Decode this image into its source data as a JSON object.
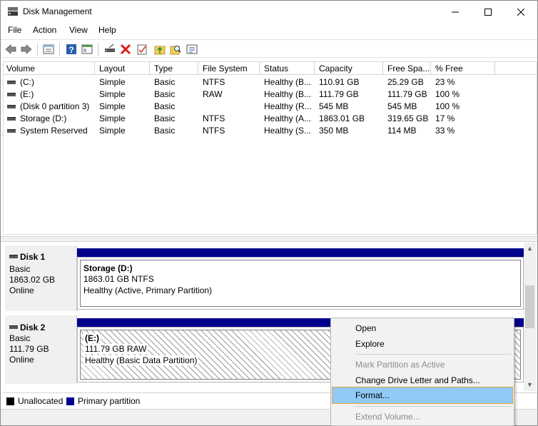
{
  "window": {
    "title": "Disk Management"
  },
  "menu": [
    "File",
    "Action",
    "View",
    "Help"
  ],
  "toolbar": {
    "icons": [
      "back-arrow-icon",
      "forward-arrow-icon",
      "properties-pane-icon",
      "help-icon",
      "console-tree-icon",
      "connect-drive-icon",
      "delete-icon",
      "check-properties-icon",
      "folder-up-icon",
      "search-folder-icon",
      "settings-list-icon"
    ],
    "accent_red": "#d81e1e",
    "accent_blue": "#2a5db0"
  },
  "volume_list": {
    "columns": [
      "Volume",
      "Layout",
      "Type",
      "File System",
      "Status",
      "Capacity",
      "Free Spa...",
      "% Free"
    ],
    "rows": [
      {
        "volume": "(C:)",
        "layout": "Simple",
        "type": "Basic",
        "fs": "NTFS",
        "status": "Healthy (B...",
        "capacity": "110.91 GB",
        "free": "25.29 GB",
        "pct": "23 %"
      },
      {
        "volume": "(E:)",
        "layout": "Simple",
        "type": "Basic",
        "fs": "RAW",
        "status": "Healthy (B...",
        "capacity": "111.79 GB",
        "free": "111.79 GB",
        "pct": "100 %"
      },
      {
        "volume": "(Disk 0 partition 3)",
        "layout": "Simple",
        "type": "Basic",
        "fs": "",
        "status": "Healthy (R...",
        "capacity": "545 MB",
        "free": "545 MB",
        "pct": "100 %"
      },
      {
        "volume": "Storage (D:)",
        "layout": "Simple",
        "type": "Basic",
        "fs": "NTFS",
        "status": "Healthy (A...",
        "capacity": "1863.01 GB",
        "free": "319.65 GB",
        "pct": "17 %"
      },
      {
        "volume": "System Reserved",
        "layout": "Simple",
        "type": "Basic",
        "fs": "NTFS",
        "status": "Healthy (S...",
        "capacity": "350 MB",
        "free": "114 MB",
        "pct": "33 %"
      }
    ]
  },
  "disks": [
    {
      "name": "Disk 1",
      "type": "Basic",
      "size": "1863.02 GB",
      "state": "Online",
      "partition": {
        "name": "Storage  (D:)",
        "detail": "1863.01 GB NTFS",
        "status": "Healthy (Active, Primary Partition)"
      }
    },
    {
      "name": "Disk 2",
      "type": "Basic",
      "size": "111.79 GB",
      "state": "Online",
      "partition": {
        "name": "(E:)",
        "detail": "111.79 GB RAW",
        "status": "Healthy (Basic Data Partition)"
      }
    }
  ],
  "legend": {
    "items": [
      {
        "label": "Unallocated",
        "color": "#000000"
      },
      {
        "label": "Primary partition",
        "color": "#00008c"
      }
    ]
  },
  "context_menu": {
    "items": [
      {
        "label": "Open",
        "disabled": false
      },
      {
        "label": "Explore",
        "disabled": false
      },
      {
        "label": "Mark Partition as Active",
        "disabled": true
      },
      {
        "label": "Change Drive Letter and Paths...",
        "disabled": false
      },
      {
        "label": "Format...",
        "disabled": false,
        "highlighted": true
      },
      {
        "label": "Extend Volume...",
        "disabled": true
      }
    ],
    "highlight_color": "#91c9f7",
    "highlight_border": "#e8a33c"
  }
}
